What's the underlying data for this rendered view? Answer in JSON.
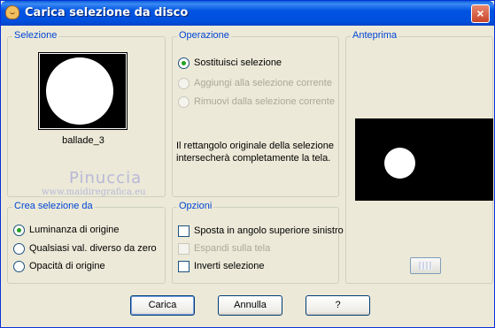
{
  "window": {
    "title": "Carica selezione da disco",
    "close_label": "×"
  },
  "selezione": {
    "title": "Selezione",
    "thumbnail_name": "ballade_3"
  },
  "watermark": {
    "name": "Pinuccia",
    "url": "www.maidiregrafica.eu"
  },
  "operazione": {
    "title": "Operazione",
    "options": [
      {
        "label": "Sostituisci selezione",
        "checked": true,
        "enabled": true
      },
      {
        "label": "Aggiungi alla selezione corrente",
        "checked": false,
        "enabled": false
      },
      {
        "label": "Rimuovi dalla selezione corrente",
        "checked": false,
        "enabled": false
      }
    ],
    "info": "Il rettangolo originale della selezione intersecherà completamente la tela."
  },
  "anteprima": {
    "title": "Anteprima"
  },
  "crea_selezione": {
    "title": "Crea selezione da",
    "options": [
      {
        "label": "Luminanza di origine",
        "checked": true
      },
      {
        "label": "Qualsiasi val. diverso da zero",
        "checked": false
      },
      {
        "label": "Opacità di origine",
        "checked": false
      }
    ]
  },
  "opzioni": {
    "title": "Opzioni",
    "options": [
      {
        "label": "Sposta in angolo superiore sinistro",
        "checked": false,
        "enabled": true
      },
      {
        "label": "Espandi sulla tela",
        "checked": false,
        "enabled": false
      },
      {
        "label": "Inverti selezione",
        "checked": false,
        "enabled": true
      }
    ]
  },
  "buttons": {
    "load": "Carica",
    "cancel": "Annulla",
    "help": "?"
  }
}
